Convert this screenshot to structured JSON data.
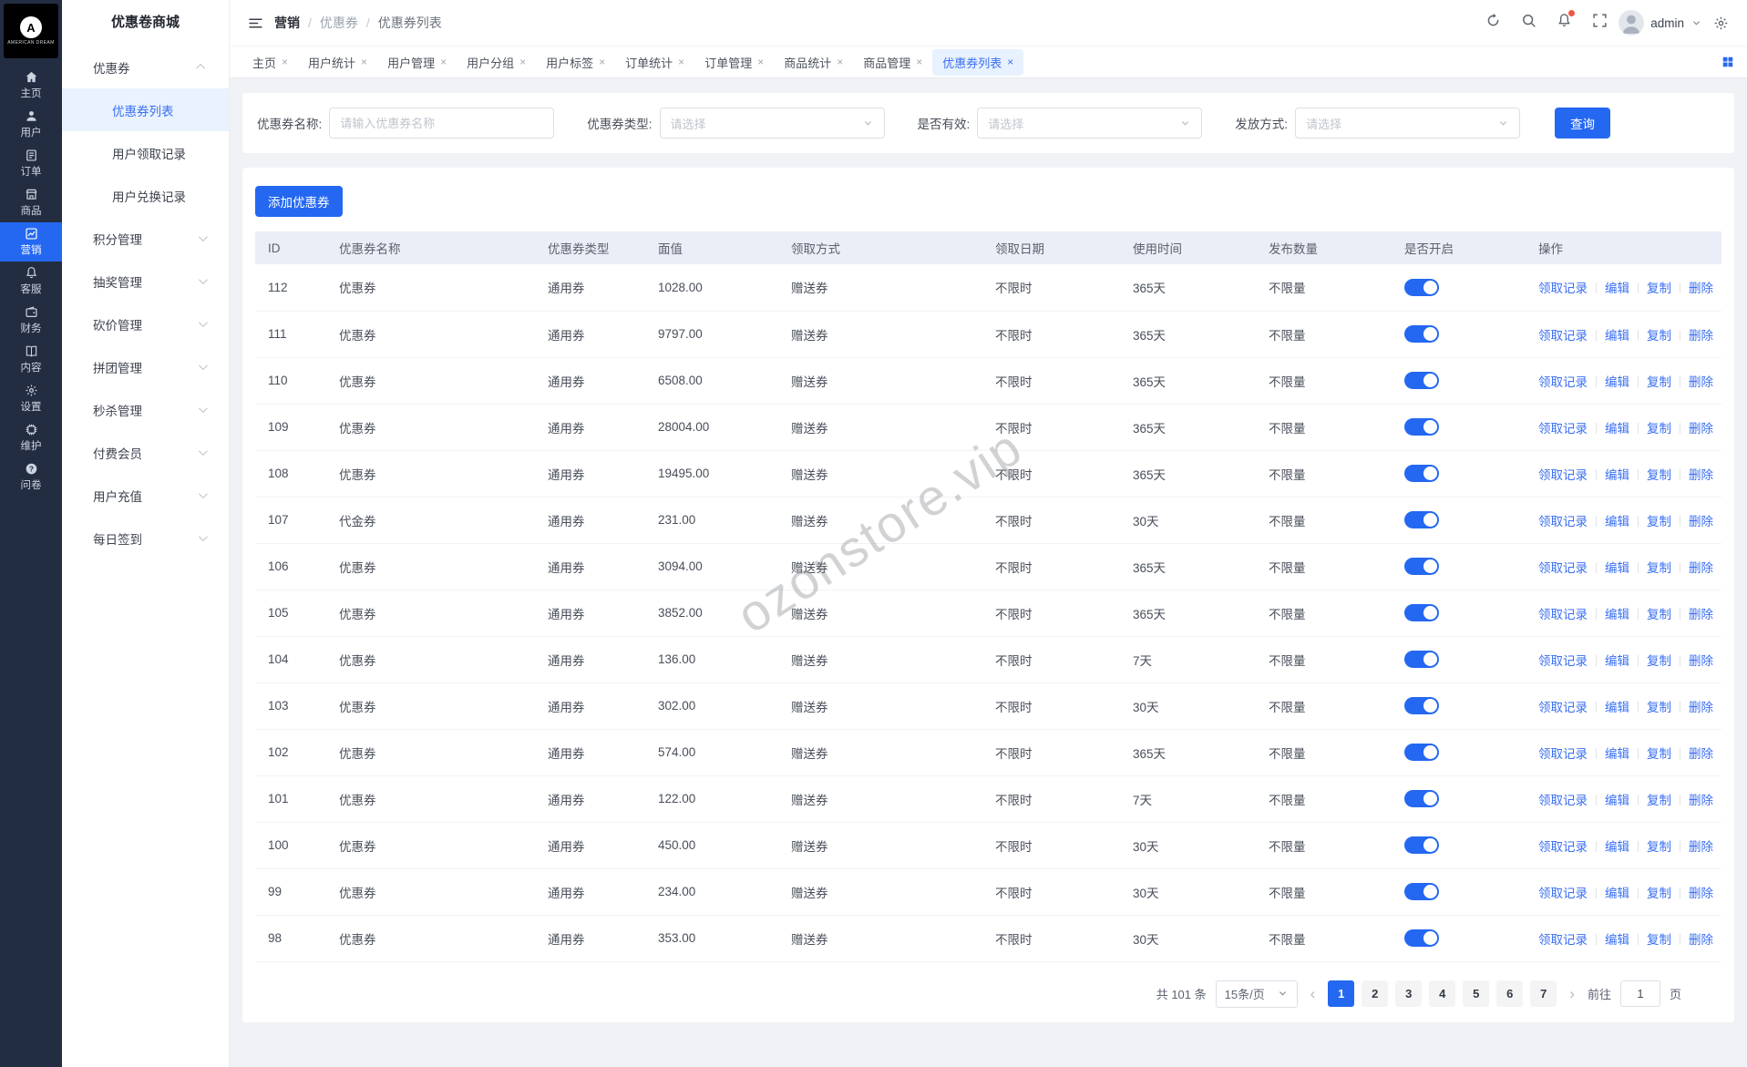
{
  "colors": {
    "accent": "#2468f2",
    "link": "#3a6ff2",
    "rail_bg": "#232d42",
    "active_tab_bg": "#e8f1fe",
    "table_header_bg": "#ebeef6"
  },
  "brand": {
    "app_title": "优惠卷商城",
    "logo_letter": "A",
    "logo_caption": "AMERICAN DREAM"
  },
  "rail": {
    "items": [
      {
        "id": "home",
        "icon": "home",
        "label": "主页",
        "active": false
      },
      {
        "id": "users",
        "icon": "user",
        "label": "用户",
        "active": false
      },
      {
        "id": "orders",
        "icon": "order",
        "label": "订单",
        "active": false
      },
      {
        "id": "goods",
        "icon": "goods",
        "label": "商品",
        "active": false
      },
      {
        "id": "marketing",
        "icon": "marketing",
        "label": "营销",
        "active": true
      },
      {
        "id": "service",
        "icon": "service",
        "label": "客服",
        "active": false
      },
      {
        "id": "finance",
        "icon": "finance",
        "label": "财务",
        "active": false
      },
      {
        "id": "content",
        "icon": "content",
        "label": "内容",
        "active": false
      },
      {
        "id": "settings",
        "icon": "settings",
        "label": "设置",
        "active": false
      },
      {
        "id": "maintain",
        "icon": "maintain",
        "label": "维护",
        "active": false
      },
      {
        "id": "survey",
        "icon": "survey",
        "label": "问卷",
        "active": false
      }
    ]
  },
  "menu": [
    {
      "kind": "group",
      "label": "优惠券",
      "caret": "up"
    },
    {
      "kind": "item",
      "label": "优惠券列表",
      "active": true
    },
    {
      "kind": "item",
      "label": "用户领取记录",
      "active": false
    },
    {
      "kind": "item",
      "label": "用户兑换记录",
      "active": false
    },
    {
      "kind": "group",
      "label": "积分管理",
      "caret": "down"
    },
    {
      "kind": "group",
      "label": "抽奖管理",
      "caret": "down"
    },
    {
      "kind": "group",
      "label": "砍价管理",
      "caret": "down"
    },
    {
      "kind": "group",
      "label": "拼团管理",
      "caret": "down"
    },
    {
      "kind": "group",
      "label": "秒杀管理",
      "caret": "down"
    },
    {
      "kind": "group",
      "label": "付费会员",
      "caret": "down"
    },
    {
      "kind": "group",
      "label": "用户充值",
      "caret": "down"
    },
    {
      "kind": "group",
      "label": "每日签到",
      "caret": "down"
    }
  ],
  "header": {
    "breadcrumb": [
      "营销",
      "优惠券",
      "优惠券列表"
    ],
    "separator": "/",
    "icons": [
      "refresh",
      "search",
      "notification",
      "fullscreen"
    ],
    "user": "admin"
  },
  "tabs": [
    {
      "label": "主页",
      "active": false
    },
    {
      "label": "用户统计",
      "active": false
    },
    {
      "label": "用户管理",
      "active": false
    },
    {
      "label": "用户分组",
      "active": false
    },
    {
      "label": "用户标签",
      "active": false
    },
    {
      "label": "订单统计",
      "active": false
    },
    {
      "label": "订单管理",
      "active": false
    },
    {
      "label": "商品统计",
      "active": false
    },
    {
      "label": "商品管理",
      "active": false
    },
    {
      "label": "优惠券列表",
      "active": true
    }
  ],
  "filters": [
    {
      "id": "coupon-name",
      "label": "优惠券名称:",
      "control": "input",
      "placeholder": "请输入优惠券名称"
    },
    {
      "id": "coupon-type",
      "label": "优惠券类型:",
      "control": "select",
      "placeholder": "请选择"
    },
    {
      "id": "is-valid",
      "label": "是否有效:",
      "control": "select",
      "placeholder": "请选择"
    },
    {
      "id": "issue-mode",
      "label": "发放方式:",
      "control": "select",
      "placeholder": "请选择"
    }
  ],
  "search_button": "查询",
  "table": {
    "add_button": "添加优惠券",
    "columns": [
      "ID",
      "优惠券名称",
      "优惠券类型",
      "面值",
      "领取方式",
      "领取日期",
      "使用时间",
      "发布数量",
      "是否开启",
      "操作"
    ],
    "actions": [
      "领取记录",
      "编辑",
      "复制",
      "删除"
    ],
    "rows": [
      {
        "id": "112",
        "name": "优惠券",
        "type": "通用券",
        "value": "1028.00",
        "receive_mode": "赠送券",
        "receive_date": "不限时",
        "use_time": "365天",
        "publish_qty": "不限量",
        "enabled": true
      },
      {
        "id": "111",
        "name": "优惠券",
        "type": "通用券",
        "value": "9797.00",
        "receive_mode": "赠送券",
        "receive_date": "不限时",
        "use_time": "365天",
        "publish_qty": "不限量",
        "enabled": true
      },
      {
        "id": "110",
        "name": "优惠券",
        "type": "通用券",
        "value": "6508.00",
        "receive_mode": "赠送券",
        "receive_date": "不限时",
        "use_time": "365天",
        "publish_qty": "不限量",
        "enabled": true
      },
      {
        "id": "109",
        "name": "优惠券",
        "type": "通用券",
        "value": "28004.00",
        "receive_mode": "赠送券",
        "receive_date": "不限时",
        "use_time": "365天",
        "publish_qty": "不限量",
        "enabled": true
      },
      {
        "id": "108",
        "name": "优惠券",
        "type": "通用券",
        "value": "19495.00",
        "receive_mode": "赠送券",
        "receive_date": "不限时",
        "use_time": "365天",
        "publish_qty": "不限量",
        "enabled": true
      },
      {
        "id": "107",
        "name": "代金券",
        "type": "通用券",
        "value": "231.00",
        "receive_mode": "赠送券",
        "receive_date": "不限时",
        "use_time": "30天",
        "publish_qty": "不限量",
        "enabled": true
      },
      {
        "id": "106",
        "name": "优惠券",
        "type": "通用券",
        "value": "3094.00",
        "receive_mode": "赠送券",
        "receive_date": "不限时",
        "use_time": "365天",
        "publish_qty": "不限量",
        "enabled": true
      },
      {
        "id": "105",
        "name": "优惠券",
        "type": "通用券",
        "value": "3852.00",
        "receive_mode": "赠送券",
        "receive_date": "不限时",
        "use_time": "365天",
        "publish_qty": "不限量",
        "enabled": true
      },
      {
        "id": "104",
        "name": "优惠券",
        "type": "通用券",
        "value": "136.00",
        "receive_mode": "赠送券",
        "receive_date": "不限时",
        "use_time": "7天",
        "publish_qty": "不限量",
        "enabled": true
      },
      {
        "id": "103",
        "name": "优惠券",
        "type": "通用券",
        "value": "302.00",
        "receive_mode": "赠送券",
        "receive_date": "不限时",
        "use_time": "30天",
        "publish_qty": "不限量",
        "enabled": true
      },
      {
        "id": "102",
        "name": "优惠券",
        "type": "通用券",
        "value": "574.00",
        "receive_mode": "赠送券",
        "receive_date": "不限时",
        "use_time": "365天",
        "publish_qty": "不限量",
        "enabled": true
      },
      {
        "id": "101",
        "name": "优惠券",
        "type": "通用券",
        "value": "122.00",
        "receive_mode": "赠送券",
        "receive_date": "不限时",
        "use_time": "7天",
        "publish_qty": "不限量",
        "enabled": true
      },
      {
        "id": "100",
        "name": "优惠券",
        "type": "通用券",
        "value": "450.00",
        "receive_mode": "赠送券",
        "receive_date": "不限时",
        "use_time": "30天",
        "publish_qty": "不限量",
        "enabled": true
      },
      {
        "id": "99",
        "name": "优惠券",
        "type": "通用券",
        "value": "234.00",
        "receive_mode": "赠送券",
        "receive_date": "不限时",
        "use_time": "30天",
        "publish_qty": "不限量",
        "enabled": true
      },
      {
        "id": "98",
        "name": "优惠券",
        "type": "通用券",
        "value": "353.00",
        "receive_mode": "赠送券",
        "receive_date": "不限时",
        "use_time": "30天",
        "publish_qty": "不限量",
        "enabled": true
      }
    ]
  },
  "pagination": {
    "total_label": "共 101 条",
    "page_size": "15条/页",
    "prev_icon": "‹",
    "next_icon": "›",
    "pages": [
      "1",
      "2",
      "3",
      "4",
      "5",
      "6",
      "7"
    ],
    "active_page": "1",
    "goto_label": "前往",
    "goto_value": "1",
    "goto_unit": "页"
  },
  "watermark": "ozonstore.vip"
}
